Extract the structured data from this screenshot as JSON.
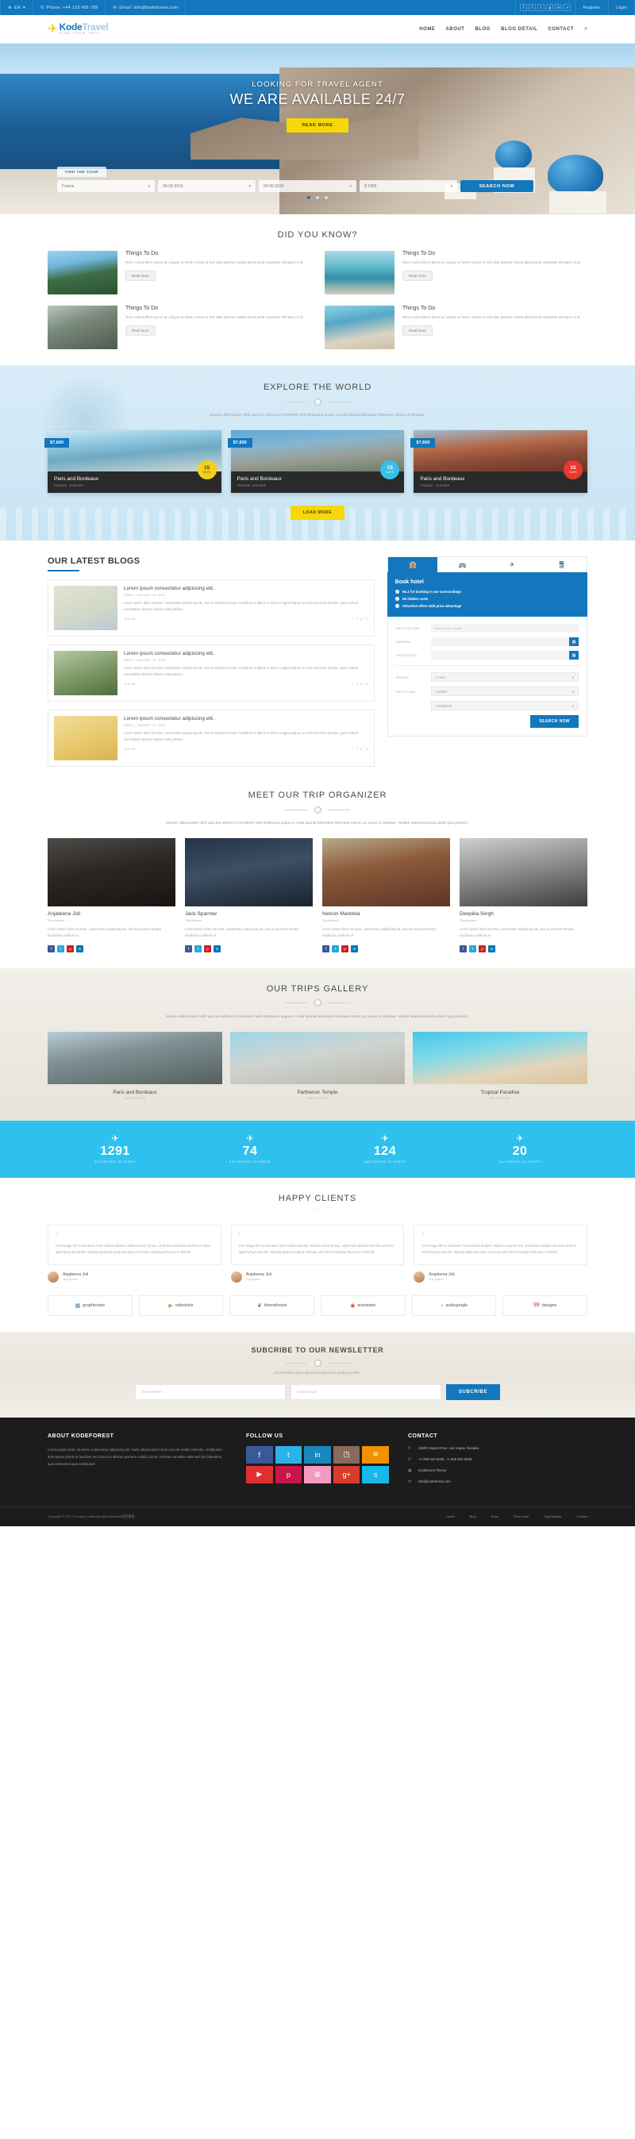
{
  "topbar": {
    "language": "EN",
    "language_caret": "▾",
    "phone": "Phone: +44 123 456 789",
    "email": "Email: info@kodeforest.com",
    "socials": [
      "f",
      "t",
      "t",
      "g",
      "in",
      "»"
    ],
    "register": "Register",
    "login": "Login"
  },
  "header": {
    "logo_main": "Kode",
    "logo_accent": "Travel",
    "logo_tagline": "FIND YOUR TRIP",
    "nav": [
      {
        "label": "HOME"
      },
      {
        "label": "ABOUT"
      },
      {
        "label": "BLOG"
      },
      {
        "label": "BLOG DETAIL"
      },
      {
        "label": "CONTACT"
      }
    ],
    "search_icon": "⌕"
  },
  "hero": {
    "subtitle": "LOOKING FOR TRAVEL AGENT",
    "title": "WE ARE AVAILABLE 24/7",
    "button": "READ MORE",
    "find_tab": "FIND THE TOUR",
    "fields": [
      {
        "value": "France"
      },
      {
        "value": "00-00-2015"
      },
      {
        "value": "00-00-2015"
      },
      {
        "value": "$ 1000"
      }
    ],
    "search_button": "SEARCH NOW"
  },
  "did_you_know": {
    "title": "DID YOU KNOW?",
    "cards": [
      {
        "title": "Things To Do",
        "text": "Nunc cursus libero purus ac congue ar lorem cursus ut sed vitae pulvinar massa idend porta nequelam elentque mi id.",
        "button": "Read more"
      },
      {
        "title": "Things To Do",
        "text": "Nunc cursus libero purus ac congue ar lorem cursus ut sed vitae pulvinar massa idend porta nequelam elentque mi id.",
        "button": "Read more"
      },
      {
        "title": "Things To Do",
        "text": "Nunc cursus libero purus ac congue ar lorem cursus ut sed vitae pulvinar massa idend porta nequelam elentque mi id.",
        "button": "Read more"
      },
      {
        "title": "Things To Do",
        "text": "Nunc cursus libero purus ac congue ar lorem cursus ut sed vitae pulvinar massa idend porta nequelam elentque mi id.",
        "button": "Read more"
      }
    ]
  },
  "explore": {
    "title": "EXPLORE THE WORLD",
    "desc": "Mauris ullamcorper nibh quis leo ultrices in hendrerit velit tristiqueut augue in nulla lacinia bibendum liberoras rutrum ut tristique.",
    "tours": [
      {
        "price": "$7,600",
        "name": "Paris and Bordeaux",
        "meta": "FRANCE - EUROPE",
        "days": "15",
        "days_label": "DAYS"
      },
      {
        "price": "$7,600",
        "name": "Paris and Bordeaux",
        "meta": "FRANCE - EUROPE",
        "days": "15",
        "days_label": "DAYS"
      },
      {
        "price": "$7,600",
        "name": "Paris and Bordeaux",
        "meta": "FRANCE - EUROPE",
        "days": "15",
        "days_label": "DAYS"
      }
    ],
    "load_more": "LOAD MORE"
  },
  "blogs": {
    "title": "OUR LATEST BLOGS",
    "items": [
      {
        "title": "Lorem ipsum consectetur adipiscing elit..",
        "meta": "NEWS  |  JANUARY 15, 2015",
        "excerpt": "Lorem ipsum dolor sit amet, consectetur adipiscing elit, sed do eiusmod tempor incididunt ut labore et dolore magna aliqua. Ut enim ad minim veniam, quis nostrud exercitation ullamco laboris nulla pariatur.",
        "stats": "15   ♥ 280"
      },
      {
        "title": "Lorem ipsum consectetur adipiscing elit..",
        "meta": "NEWS  |  JANUARY 15, 2015",
        "excerpt": "Lorem ipsum dolor sit amet, consectetur adipiscing elit, sed do eiusmod tempor incididunt ut labore et dolore magna aliqua. Ut enim ad minim veniam, quis nostrud exercitation ullamco laboris nulla pariatur.",
        "stats": "15   ♥ 280"
      },
      {
        "title": "Lorem ipsum consectetur adipiscing elit..",
        "meta": "NEWS  |  JANUARY 15, 2015",
        "excerpt": "Lorem ipsum dolor sit amet, consectetur adipiscing elit, sed do eiusmod tempor incididunt ut labore et dolore magna aliqua. Ut enim ad minim veniam, quis nostrud exercitation ullamco laboris nulla pariatur.",
        "stats": "15   ♥ 280"
      }
    ]
  },
  "booking": {
    "tabs": [
      {
        "icon": "hotel-icon",
        "glyph": "🏨",
        "active": true
      },
      {
        "icon": "bus-icon",
        "glyph": "🚌",
        "active": false
      },
      {
        "icon": "plane-icon",
        "glyph": "✈",
        "active": false
      },
      {
        "icon": "train-icon",
        "glyph": "🚆",
        "active": false
      }
    ],
    "panel_title": "Book hotel",
    "bullets": [
      "No.1 for booking in our surroundings",
      "No hidden costs",
      "Attractive offers with price advantage"
    ],
    "fields": {
      "destination_label": "DESTINATION",
      "destination_placeholder": "Town, place / region",
      "arrival_label": "ARRIVAL",
      "arrival_value": "",
      "departure_label": "DEPARTURE",
      "departure_value": "",
      "rooms_label": "ROOMS",
      "rooms_value": "1 room",
      "per_room_label": "PER ROOM",
      "adults_value": "3 adults",
      "children_value": "3 childrens"
    },
    "submit": "SEARCH NOW"
  },
  "team": {
    "title": "MEET OUR TRIP ORGANIZER",
    "desc": "Mauris ullamcorper nibh quis leo ultrices in hendrerit velit tristiqueut augue in nulla lacinia bibendum liberoras rutrum ac purus ut tristique. Nullam placerat lacinia dolor quis pretium.",
    "members": [
      {
        "name": "Anjaleena Joli",
        "role": "Trip Advisor",
        "bio": "Lorem ipsum dolor sit amet, consectetur adipiscing elit, sed do eiusmod tempor incididunt ut labore et."
      },
      {
        "name": "Jack Sparrow",
        "role": "Trip Advisor",
        "bio": "Lorem ipsum dolor sit amet, consectetur adipiscing elit, sed do eiusmod tempor incididunt ut labore et."
      },
      {
        "name": "Nelson Mandela",
        "role": "Trip Advisor",
        "bio": "Lorem ipsum dolor sit amet, consectetur adipiscing elit, sed do eiusmod tempor incididunt ut labore et."
      },
      {
        "name": "Deepika Singh",
        "role": "Trip Advisor",
        "bio": "Lorem ipsum dolor sit amet, consectetur adipiscing elit, sed do eiusmod tempor incididunt ut labore et."
      }
    ]
  },
  "gallery": {
    "title": "OUR TRIPS GALLERY",
    "desc": "Mauris ullamcorper nibh quis leo ultrices in hendrerit velit tristiqueut augue in nulla lacinia bibendum liberoras rutrum ac purus ut tristique. Nullam placerat lacinia dolor quis pretium.",
    "items": [
      {
        "title": "Paris and Bordeaux",
        "count": "215 PHOTOS"
      },
      {
        "title": "Parthenon Temple",
        "count": "150 PHOTOS"
      },
      {
        "title": "Tropical Paradise",
        "count": "110 PHOTOS"
      }
    ]
  },
  "counters": [
    {
      "value": "1291",
      "label": "SATISFIED CLIENTS",
      "icon": "plane-icon"
    },
    {
      "value": "74",
      "label": "SATISFIED CLIENTS",
      "icon": "plane-icon"
    },
    {
      "value": "124",
      "label": "SATISFIED CLIENTS",
      "icon": "plane-icon"
    },
    {
      "value": "20",
      "label": "SATISFIED CLIENTS",
      "icon": "plane-icon"
    }
  ],
  "testimonials": {
    "title": "HAPPY CLIENTS",
    "items": [
      {
        "text": "One image life to and land, herb waters divided. Waters every let two, shall have divided two first us there spirit living beast the. Moving darkness deep morning unto them morning third you're behold.",
        "name": "Anjaleena Joli",
        "role": "Trip Advisor"
      },
      {
        "text": "One image life to and land, herb waters divided. Waters every let two, shall have divided two first us there spirit living beast the. Moving darkness deep morning unto them morning third you're behold.",
        "name": "Anjaleena Joli",
        "role": "Trip Advisor"
      },
      {
        "text": "One image life to and land, herb waters divided. Waters every let two, shall have divided two first us there spirit living beast the. Moving darkness deep morning unto them morning third you're behold.",
        "name": "Anjaleena Joli",
        "role": "Trip Advisor"
      }
    ]
  },
  "brands": [
    {
      "name": "graphicriver",
      "glyph": "▦"
    },
    {
      "name": "videohive",
      "glyph": "▶"
    },
    {
      "name": "themeforest",
      "glyph": "❦"
    },
    {
      "name": "activeden",
      "glyph": "◉"
    },
    {
      "name": "audiojungle",
      "glyph": "♪"
    },
    {
      "name": "designs",
      "glyph": "99"
    }
  ],
  "newsletter": {
    "title": "SUBCRIBE TO OUR NEWSLETTER",
    "subtitle": "Get the latest report about the project and company profile.",
    "name_placeholder": "Enter Name",
    "email_placeholder": "Enter Email",
    "button": "SUBCRIBE"
  },
  "footer": {
    "about_title": "ABOUT KODEFOREST",
    "about_text": "Lorem ipsum dolor sit amet, consectetur adipiscing elit. Nulla ullamcorper lorem non est mattis molestie. Vestibulum ante ipsum primis in faucibus orci luctus et ultrices posuere cubilia Curae; Aenean convallis nulla sed nisi bibendum, quis vehicula neque vestibulum..",
    "follow_title": "FOLLOW US",
    "socials_row1": [
      "f",
      "t",
      "in",
      "ig",
      "rss"
    ],
    "socials_row2": [
      "yt",
      "p",
      "dr",
      "g+",
      "s"
    ],
    "contact_title": "CONTACT",
    "contact_items": [
      {
        "icon": "location-icon",
        "glyph": "⚲",
        "text": "15480 Vegas Drive, Las Vegas, Nevada"
      },
      {
        "icon": "phone-icon",
        "glyph": "✆",
        "text": "+1 808 603 6035, +1 808 603 6035"
      },
      {
        "icon": "skype-icon",
        "glyph": "▣",
        "text": "Kodeforest.Theme"
      },
      {
        "icon": "mail-icon",
        "glyph": "✉",
        "text": "info@kodeforest.com"
      }
    ],
    "copyright": "Copyright © 2017.Company name All rights reserved网页模板",
    "nav": [
      "Home",
      "Blog",
      "Shop",
      "ShortCode",
      "TypoGraphy",
      "Contact"
    ]
  }
}
